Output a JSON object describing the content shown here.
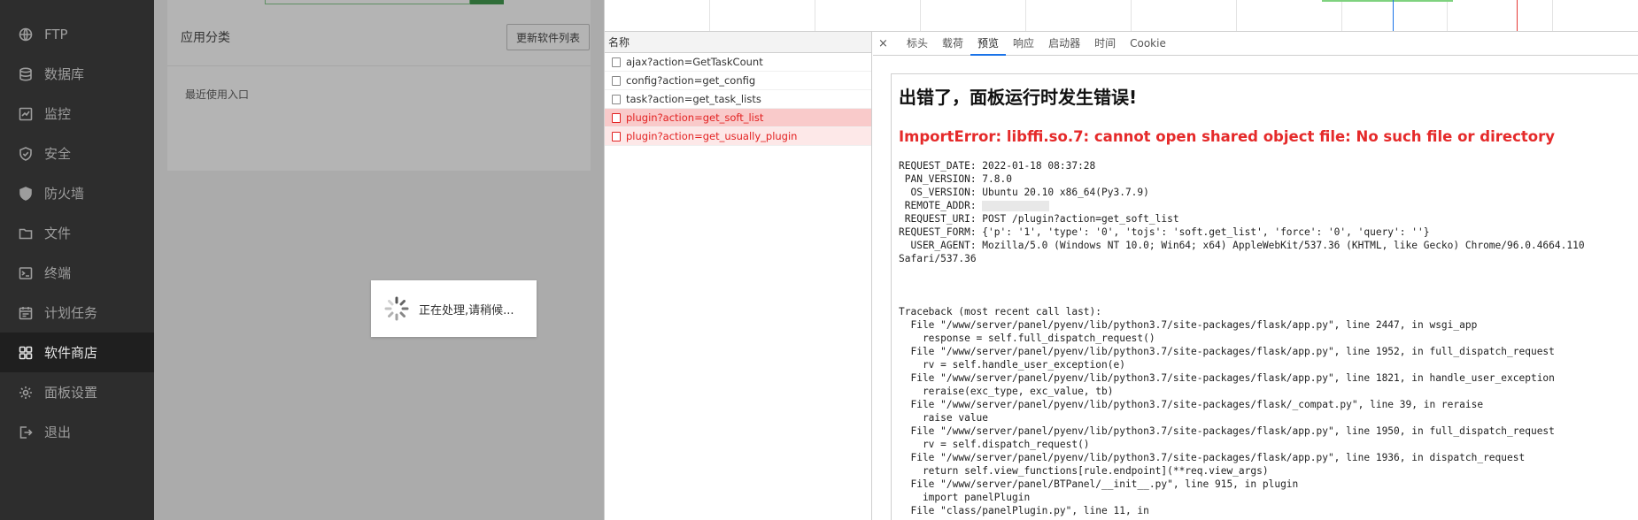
{
  "sidebar": {
    "items": [
      {
        "label": "FTP",
        "icon": "globe-icon",
        "active": false
      },
      {
        "label": "数据库",
        "icon": "database-icon",
        "active": false
      },
      {
        "label": "监控",
        "icon": "monitor-icon",
        "active": false
      },
      {
        "label": "安全",
        "icon": "shield-icon",
        "active": false
      },
      {
        "label": "防火墙",
        "icon": "firewall-icon",
        "active": false
      },
      {
        "label": "文件",
        "icon": "folder-icon",
        "active": false
      },
      {
        "label": "终端",
        "icon": "terminal-icon",
        "active": false
      },
      {
        "label": "计划任务",
        "icon": "calendar-icon",
        "active": false
      },
      {
        "label": "软件商店",
        "icon": "grid-icon",
        "active": true
      },
      {
        "label": "面板设置",
        "icon": "gear-icon",
        "active": false
      },
      {
        "label": "退出",
        "icon": "logout-icon",
        "active": false
      }
    ]
  },
  "panel": {
    "category_title": "应用分类",
    "refresh_button": "更新软件列表",
    "recent_label": "最近使用入口"
  },
  "loading": {
    "message": "正在处理,请稍候..."
  },
  "devtools": {
    "list_header": "名称",
    "requests": [
      {
        "name": "ajax?action=GetTaskCount",
        "error": false,
        "selected": false
      },
      {
        "name": "config?action=get_config",
        "error": false,
        "selected": false
      },
      {
        "name": "task?action=get_task_lists",
        "error": false,
        "selected": false
      },
      {
        "name": "plugin?action=get_soft_list",
        "error": true,
        "selected": true
      },
      {
        "name": "plugin?action=get_usually_plugin",
        "error": true,
        "selected": false
      }
    ],
    "close_label": "×",
    "tabs": [
      "标头",
      "载荷",
      "预览",
      "响应",
      "启动器",
      "时间",
      "Cookie"
    ],
    "active_tab": "预览",
    "preview": {
      "heading": "出错了，面板运行时发生错误!",
      "error": "ImportError: libffi.so.7: cannot open shared object file: No such file or directory",
      "request_date": "REQUEST_DATE: 2022-01-18 08:37:28",
      "pan_version": " PAN_VERSION: 7.8.0",
      "os_version": "  OS_VERSION: Ubuntu 20.10 x86_64(Py3.7.9)",
      "remote_addr": " REMOTE_ADDR: ",
      "request_uri": " REQUEST_URI: POST /plugin?action=get_soft_list",
      "request_form": "REQUEST_FORM: {'p': '1', 'type': '0', 'tojs': 'soft.get_list', 'force': '0', 'query': ''}",
      "user_agent": "  USER_AGENT: Mozilla/5.0 (Windows NT 10.0; Win64; x64) AppleWebKit/537.36 (KHTML, like Gecko) Chrome/96.0.4664.110",
      "user_agent_cont": "Safari/537.36",
      "traceback": "Traceback (most recent call last):\n  File \"/www/server/panel/pyenv/lib/python3.7/site-packages/flask/app.py\", line 2447, in wsgi_app\n    response = self.full_dispatch_request()\n  File \"/www/server/panel/pyenv/lib/python3.7/site-packages/flask/app.py\", line 1952, in full_dispatch_request\n    rv = self.handle_user_exception(e)\n  File \"/www/server/panel/pyenv/lib/python3.7/site-packages/flask/app.py\", line 1821, in handle_user_exception\n    reraise(exc_type, exc_value, tb)\n  File \"/www/server/panel/pyenv/lib/python3.7/site-packages/flask/_compat.py\", line 39, in reraise\n    raise value\n  File \"/www/server/panel/pyenv/lib/python3.7/site-packages/flask/app.py\", line 1950, in full_dispatch_request\n    rv = self.dispatch_request()\n  File \"/www/server/panel/pyenv/lib/python3.7/site-packages/flask/app.py\", line 1936, in dispatch_request\n    return self.view_functions[rule.endpoint](**req.view_args)\n  File \"/www/server/panel/BTPanel/__init__.py\", line 915, in plugin\n    import panelPlugin\n  File \"class/panelPlugin.py\", line 11, in"
    }
  }
}
